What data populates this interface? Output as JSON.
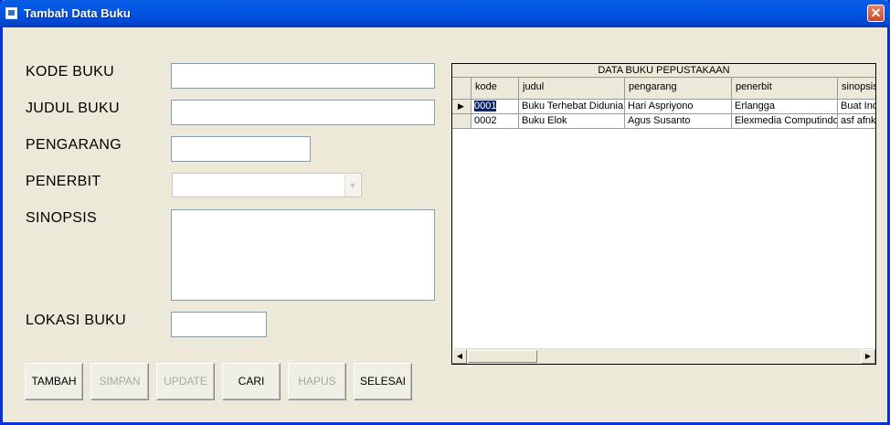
{
  "window": {
    "title": "Tambah Data Buku"
  },
  "form": {
    "kode_label": "KODE BUKU",
    "judul_label": "JUDUL BUKU",
    "pengarang_label": "PENGARANG",
    "penerbit_label": "PENERBIT",
    "sinopsis_label": "SINOPSIS",
    "lokasi_label": "LOKASI BUKU",
    "kode_value": "",
    "judul_value": "",
    "pengarang_value": "",
    "penerbit_value": "",
    "sinopsis_value": "",
    "lokasi_value": ""
  },
  "buttons": {
    "tambah": "TAMBAH",
    "simpan": "SIMPAN",
    "update": "UPDATE",
    "cari": "CARI",
    "hapus": "HAPUS",
    "selesai": "SELESAI"
  },
  "grid": {
    "caption": "DATA BUKU PEPUSTAKAAN",
    "columns": [
      "kode",
      "judul",
      "pengarang",
      "penerbit",
      "sinopsis"
    ],
    "rows": [
      [
        "0001",
        "Buku Terhebat Didunia",
        "Hari Aspriyono",
        "Erlangga",
        "Buat Ind"
      ],
      [
        "0002",
        "Buku Elok",
        "Agus Susanto",
        "Elexmedia Computindo",
        "asf afnka"
      ]
    ]
  },
  "colors": {
    "titlebar": "#0058e6",
    "selection": "#0a246a"
  }
}
